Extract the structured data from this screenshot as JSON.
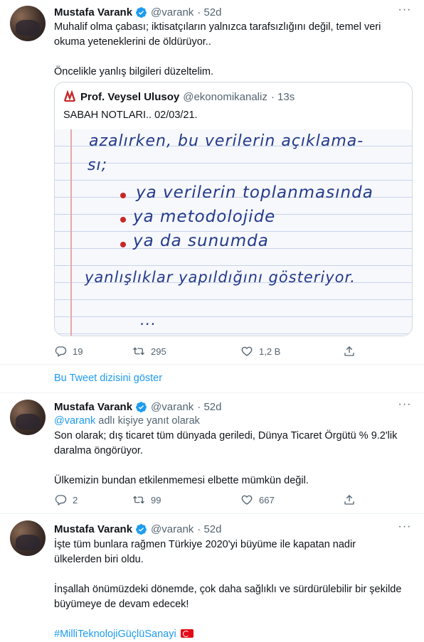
{
  "tweet1": {
    "name": "Mustafa Varank",
    "handle": "@varank",
    "time": "· 52d",
    "text_line1": "Muhalif olma çabası; iktisatçıların yalnızca tarafsızlığını değil, temel veri",
    "text_line2": "okuma yeteneklerini de öldürüyor..",
    "text_line3": "Öncelikle yanlış bilgileri düzeltelim.",
    "quote": {
      "name": "Prof. Veysel Ulusoy",
      "handle": "@ekonomikanaliz",
      "time": "· 13s",
      "text": "SABAH NOTLARI.. 02/03/21.",
      "handwriting": {
        "line1": "azalırken, bu verilerin açıklama-",
        "line2": "sı;",
        "bullet1": "ya verilerin toplanmasında",
        "bullet2": "ya metodolojide",
        "bullet3": "ya da sunumda",
        "line6": "yanlışlıklar yapıldığını gösteriyor.",
        "line7": "... "
      }
    },
    "replies": "19",
    "retweets": "295",
    "likes": "1,2 B"
  },
  "thread_link": "Bu Tweet dizisini göster",
  "tweet2": {
    "name": "Mustafa Varank",
    "handle": "@varank",
    "time": "· 52d",
    "reply_handle": "@varank",
    "reply_suffix": " adlı kişiye yanıt olarak",
    "text_line1": "Son olarak; dış ticaret tüm dünyada geriledi, Dünya Ticaret Örgütü % 9.2'lik",
    "text_line2": "daralma öngörüyor.",
    "text_line3": "Ülkemizin bundan etkilenmemesi elbette mümkün değil.",
    "replies": "2",
    "retweets": "99",
    "likes": "667"
  },
  "tweet3": {
    "name": "Mustafa Varank",
    "handle": "@varank",
    "time": "· 52d",
    "text_line1": "İşte tüm bunlara rağmen Türkiye 2020'yi büyüme ile kapatan nadir",
    "text_line2": "ülkelerden biri oldu.",
    "text_line3": "İnşallah önümüzdeki dönemde, çok daha sağlıklı ve sürdürülebilir bir şekilde",
    "text_line4": "büyümeye de devam edecek!",
    "hashtag": "#MilliTeknolojiGüçlüSanayi"
  },
  "colors": {
    "accent": "#1d9bf0",
    "muted": "#536471",
    "border": "#cfd9de",
    "flag": "#e30a17"
  },
  "icons": [
    "verified-badge-icon",
    "more-icon",
    "reply-icon",
    "retweet-icon",
    "like-icon",
    "share-icon",
    "turkey-flag-icon",
    "ekonomikanaliz-logo"
  ]
}
